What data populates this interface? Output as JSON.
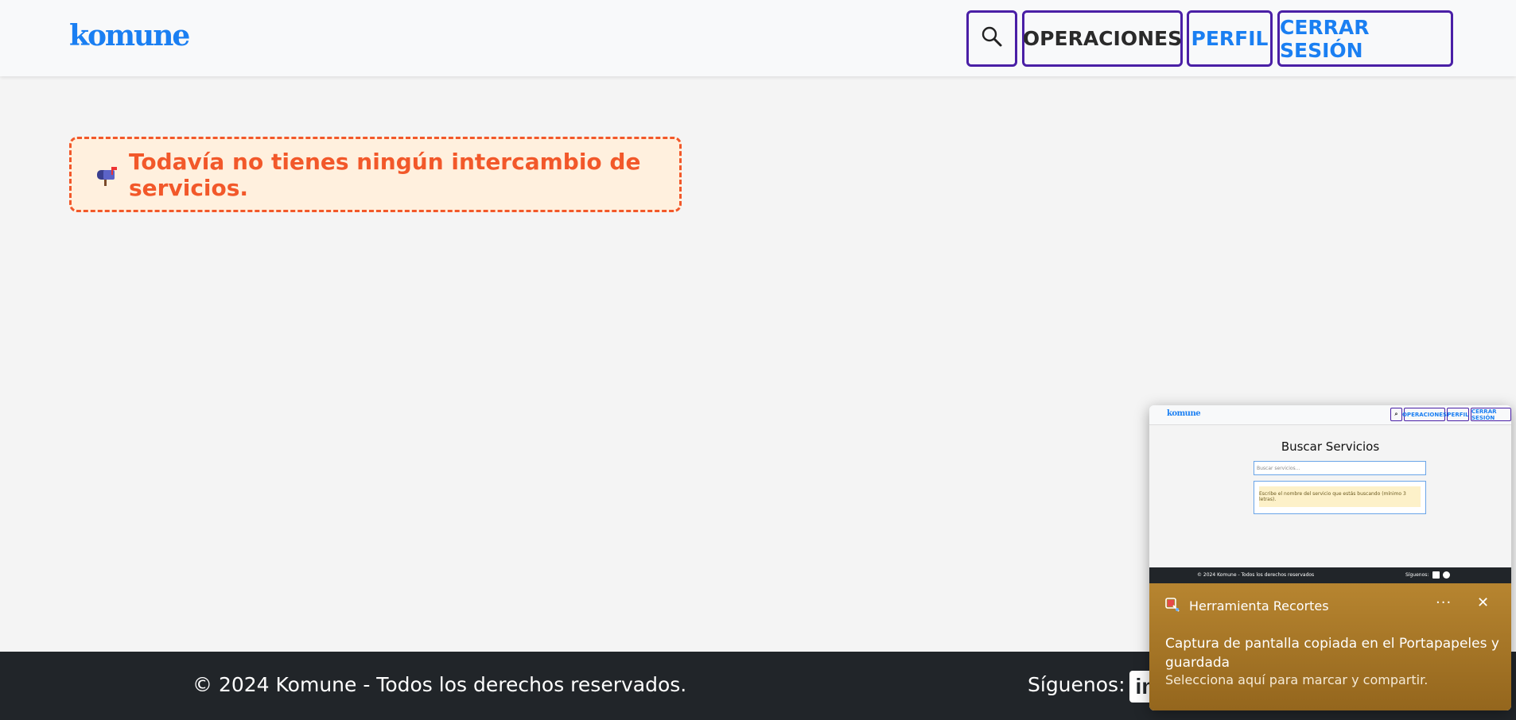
{
  "header": {
    "brand": "komune",
    "search_icon": "search-icon",
    "operations_label": "OPERACIONES",
    "profile_label": "PERFIL",
    "logout_label": "CERRAR SESIÓN"
  },
  "main": {
    "empty_icon": "mailbox-icon",
    "empty_message": "Todavía no tienes ningún intercambio de servicios."
  },
  "footer": {
    "copyright": "© 2024 Komune - Todos los derechos reservados.",
    "follow_label": "Síguenos:",
    "linkedin_icon": "linkedin-icon",
    "linkedin_text": "in"
  },
  "toast": {
    "app_name": "Herramienta Recortes",
    "app_icon": "snipping-tool-icon",
    "more_label": "···",
    "close_icon": "close-icon",
    "headline": "Captura de pantalla copiada en el Portapapeles y guardada",
    "subtext": "Selecciona aquí para marcar y compartir.",
    "thumbnail": {
      "brand": "komune",
      "nav_operations": "OPERACIONES",
      "nav_profile": "PERFIL",
      "nav_logout": "CERRAR SESIÓN",
      "title": "Buscar Servicios",
      "input_placeholder": "Buscar servicios...",
      "warning": "Escribe el nombre del servicio que estás buscando (mínimo 3 letras).",
      "footer_copy": "© 2024 Komune - Todos los derechos reservados",
      "footer_follow": "Síguenos:"
    }
  },
  "colors": {
    "brand": "#1a7ff2",
    "nav_border": "#4a1fa6",
    "alert_text": "#f2582a",
    "alert_bg": "#fff0de",
    "footer_bg": "#212529"
  }
}
